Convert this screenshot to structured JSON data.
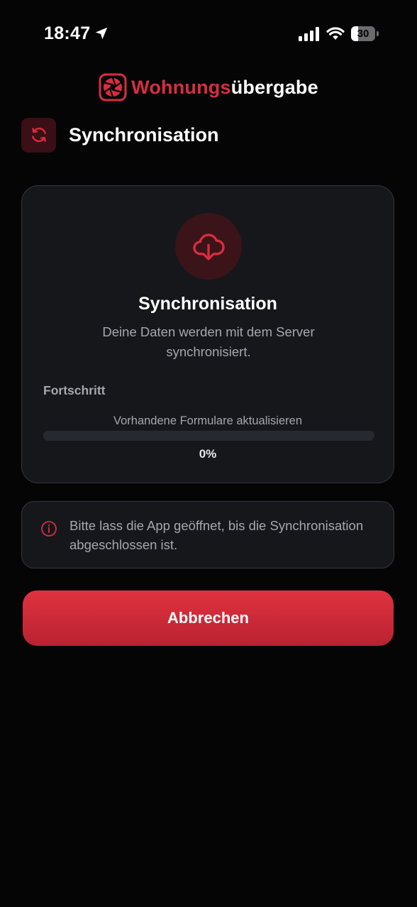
{
  "status_bar": {
    "time": "18:47",
    "battery_level": "30",
    "battery_fraction": 0.3
  },
  "brand": {
    "name_accent": "Wohnungs",
    "name_rest": "übergabe",
    "accent_color": "#d92d3f"
  },
  "header": {
    "title": "Synchronisation",
    "icon": "sync-icon"
  },
  "sync_card": {
    "icon": "cloud-download-icon",
    "title": "Synchronisation",
    "description": "Deine Daten werden mit dem Server synchronisiert.",
    "progress_label": "Fortschritt",
    "current_step": "Vorhandene Formulare aktualisieren",
    "progress_percent_text": "0%",
    "progress_fraction": 0
  },
  "info": {
    "icon": "info-icon",
    "text": "Bitte lass die App geöffnet, bis die Synchronisation abgeschlossen ist."
  },
  "actions": {
    "cancel_label": "Abbrechen"
  },
  "colors": {
    "background": "#050506",
    "card": "#15171b",
    "accent": "#d92d3f",
    "muted_text": "#a4a7ae"
  }
}
